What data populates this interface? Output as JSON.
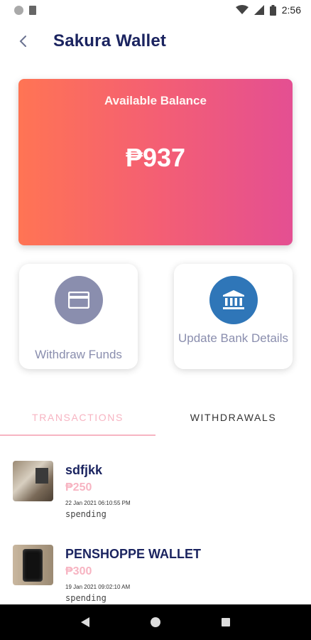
{
  "status_bar": {
    "time": "2:56",
    "icons": [
      "circle-icon",
      "sd-card-icon",
      "wifi-icon",
      "signal-icon",
      "battery-icon"
    ]
  },
  "header": {
    "title": "Sakura Wallet",
    "back_icon": "chevron-left-icon"
  },
  "balance_card": {
    "label": "Available Balance",
    "amount": "₱937",
    "gradient": [
      "#ff7454",
      "#e44f92"
    ]
  },
  "actions": [
    {
      "label": "Withdraw Funds",
      "icon": "card-icon",
      "color": "#8a8eae"
    },
    {
      "label": "Update Bank Details",
      "icon": "bank-icon",
      "color": "#2f76b8"
    }
  ],
  "tabs": [
    {
      "label": "TRANSACTIONS",
      "active": true
    },
    {
      "label": "WITHDRAWALS",
      "active": false
    }
  ],
  "transactions": [
    {
      "name": "sdfjkk",
      "amount": "₱250",
      "date": "22 Jan 2021 06:10:55 PM",
      "type": "spending"
    },
    {
      "name": "PENSHOPPE WALLET",
      "amount": "₱300",
      "date": "19 Jan 2021 09:02:10 AM",
      "type": "spending"
    }
  ],
  "colors": {
    "accent_pink": "#f7b4c2",
    "title_navy": "#1b2460",
    "muted_icon": "#8a8eae",
    "bank_blue": "#2f76b8"
  },
  "nav_bar": {
    "buttons": [
      "back-triangle-icon",
      "home-circle-icon",
      "recents-square-icon"
    ]
  }
}
